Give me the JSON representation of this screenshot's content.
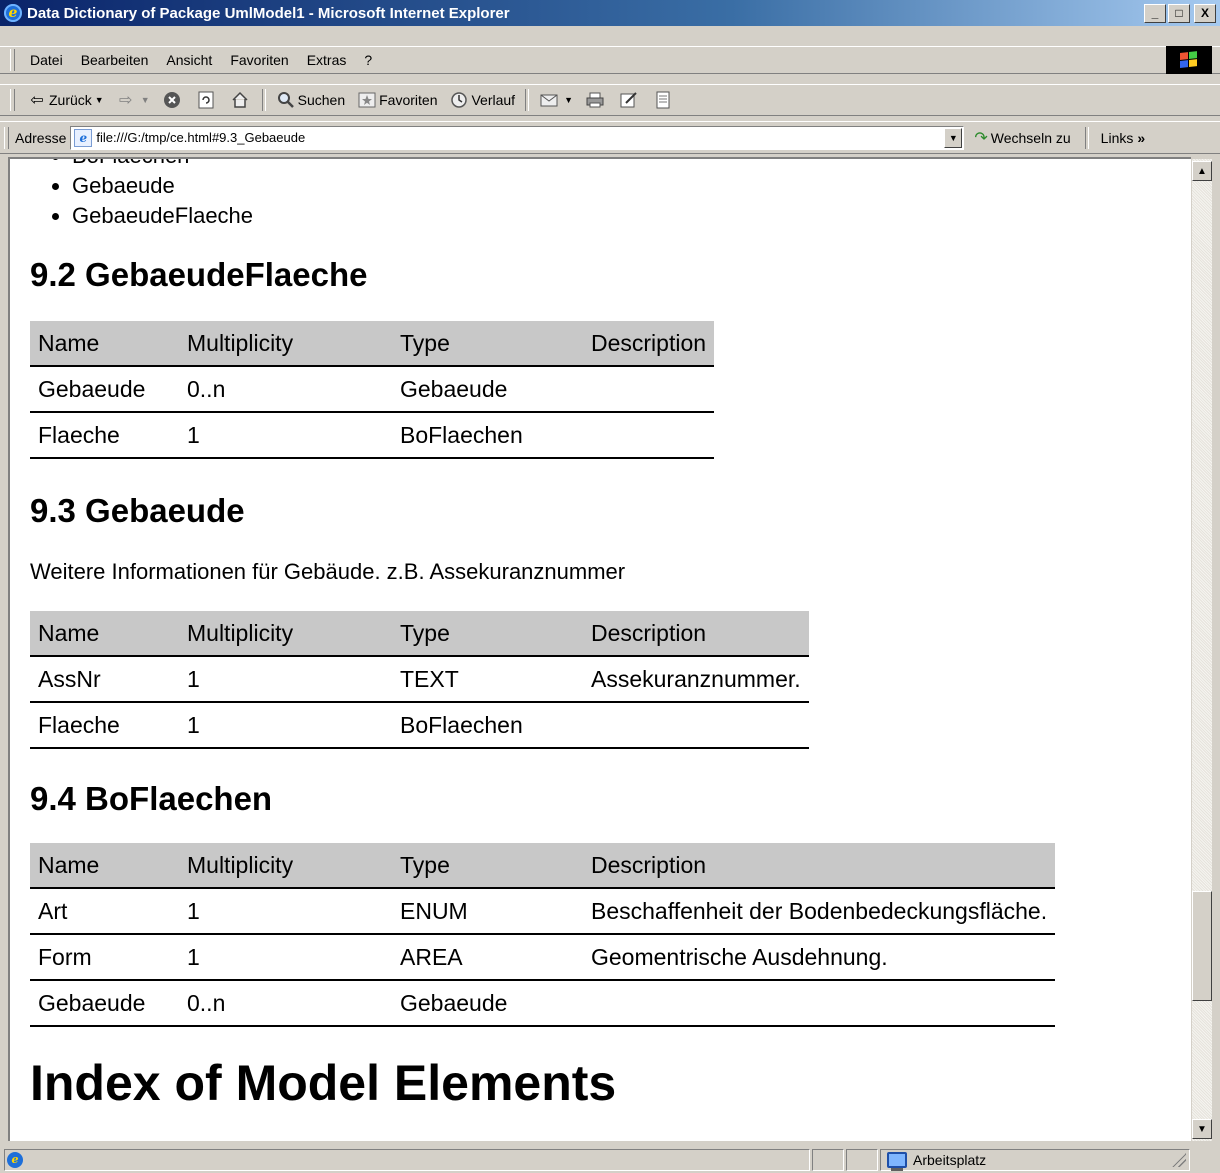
{
  "window": {
    "title": "Data Dictionary of Package UmlModel1 - Microsoft Internet Explorer",
    "controls": {
      "minimize": "_",
      "maximize": "□",
      "close": "X"
    }
  },
  "menu": [
    "Datei",
    "Bearbeiten",
    "Ansicht",
    "Favoriten",
    "Extras",
    "?"
  ],
  "toolbar": {
    "back": "Zurück",
    "search": "Suchen",
    "favorites": "Favoriten",
    "history": "Verlauf"
  },
  "address": {
    "label": "Adresse",
    "value": "file:///G:/tmp/ce.html#9.3_Gebaeude",
    "go": "Wechseln zu",
    "links": "Links"
  },
  "content": {
    "list_items": [
      "BoFlaechen",
      "Gebaeude",
      "GebaeudeFlaeche"
    ],
    "sections": [
      {
        "heading": "9.2 GebaeudeFlaeche",
        "description": "",
        "columns": [
          "Name",
          "Multiplicity",
          "Type",
          "Description"
        ],
        "rows": [
          [
            "Gebaeude",
            "0..n",
            "Gebaeude",
            ""
          ],
          [
            "Flaeche",
            "1",
            "BoFlaechen",
            ""
          ]
        ]
      },
      {
        "heading": "9.3 Gebaeude",
        "description": "Weitere Informationen für Gebäude. z.B. Assekuranznummer",
        "columns": [
          "Name",
          "Multiplicity",
          "Type",
          "Description"
        ],
        "rows": [
          [
            "AssNr",
            "1",
            "TEXT",
            "Assekuranznummer."
          ],
          [
            "Flaeche",
            "1",
            "BoFlaechen",
            ""
          ]
        ]
      },
      {
        "heading": "9.4 BoFlaechen",
        "description": "",
        "columns": [
          "Name",
          "Multiplicity",
          "Type",
          "Description"
        ],
        "rows": [
          [
            "Art",
            "1",
            "ENUM",
            "Beschaffenheit der Bodenbedeckungsfläche."
          ],
          [
            "Form",
            "1",
            "AREA",
            "Geomentrische Ausdehnung."
          ],
          [
            "Gebaeude",
            "0..n",
            "Gebaeude",
            ""
          ]
        ]
      }
    ],
    "index_heading": "Index of Model Elements"
  },
  "status": {
    "zone": "Arbeitsplatz"
  },
  "colors": {
    "titlebar_start": "#0a246a",
    "titlebar_end": "#a6caf0",
    "chrome": "#d4d0c8",
    "table_header": "#c8c8c8"
  }
}
